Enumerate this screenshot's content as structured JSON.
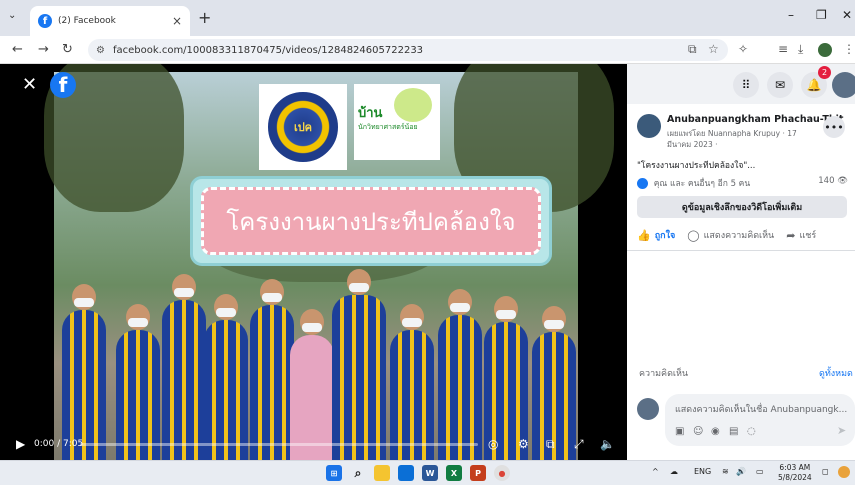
{
  "browser": {
    "tab_title": "(2) Facebook",
    "url": "facebook.com/100083311870475/videos/1284824605722233",
    "new_tab_symbol": "+",
    "tab_close_symbol": "×"
  },
  "video": {
    "logo1_text": "เปค",
    "logo2_title": "บ้าน",
    "logo2_subtitle": "นักวิทยาศาสตร์น้อย",
    "banner_text": "โครงงานผางประทีปคล้องใจ",
    "time_display": "0:00 / 7:05",
    "progress_fraction": 0.0
  },
  "panel": {
    "notification_count": "2",
    "author": "Anubanpuangkham Phachau-Thit",
    "post_meta": "เผยแพร่โดย Nuannapha Krupuy · 17 มีนาคม 2023 ·",
    "caption": "\"โครงงานผางประทีปคล้องใจ\"...",
    "reactions_text": "คุณ และ คนอื่นๆ อีก 5 คน",
    "views": "140",
    "insights_button": "ดูข้อมูลเชิงลึกของวิดีโอเพิ่มเติม",
    "like_label": "ถูกใจ",
    "comment_label": "แสดงความคิดเห็น",
    "share_label": "แชร์",
    "comments_heading": "ความคิดเห็น",
    "see_all": "ดูทั้งหมด",
    "comment_placeholder": "แสดงความคิดเห็นในชื่อ Anubanpuangk..."
  },
  "taskbar": {
    "lang": "ENG",
    "time": "6:03 AM",
    "date": "5/8/2024"
  },
  "colors": {
    "facebook_blue": "#1877f2",
    "banner_pink": "#f0a7b3",
    "banner_teal": "#b8e6e8",
    "badge_red": "#e41e3f"
  }
}
